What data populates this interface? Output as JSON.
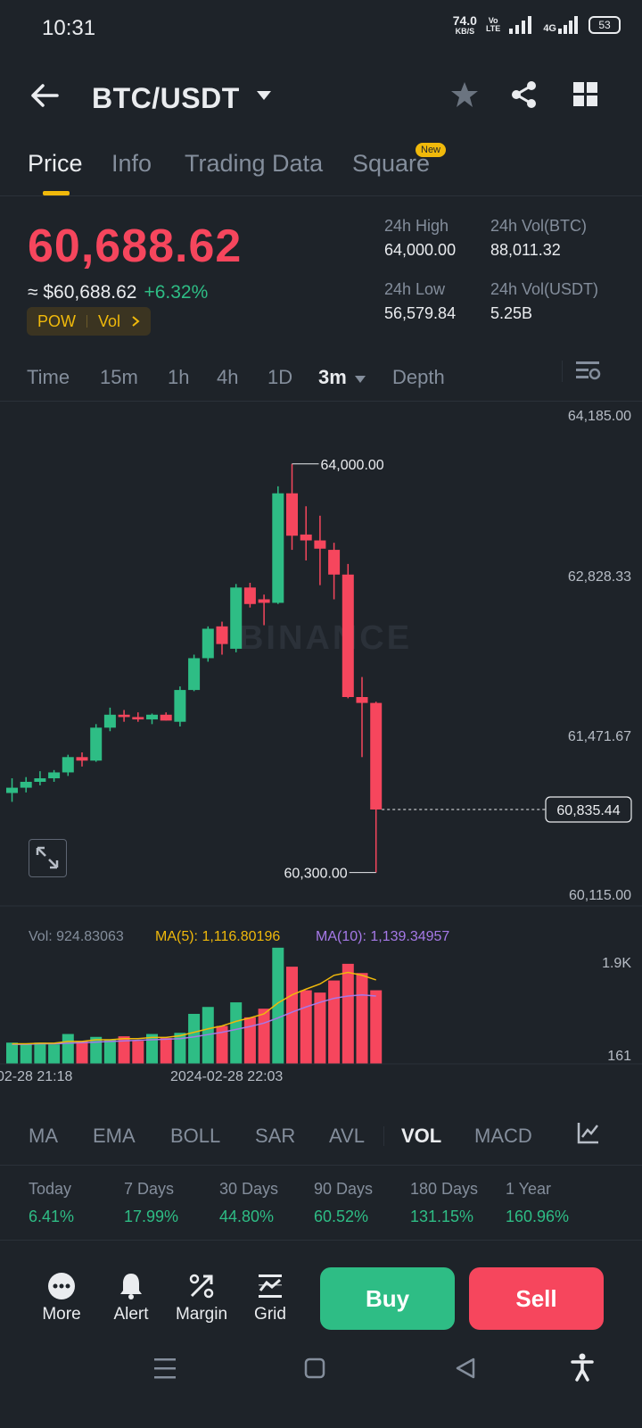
{
  "status": {
    "time": "10:31",
    "netspeed_value": "74.0",
    "netspeed_unit": "KB/S",
    "volte_top": "Vo",
    "volte_bottom": "LTE",
    "network": "4G",
    "battery": "53"
  },
  "header": {
    "pair": "BTC/USDT"
  },
  "tabs": [
    {
      "label": "Price"
    },
    {
      "label": "Info"
    },
    {
      "label": "Trading Data"
    },
    {
      "label": "Square",
      "badge": "New"
    }
  ],
  "ticker": {
    "last_price": "60,688.62",
    "fiat_price": "≈ $60,688.62",
    "change": "+6.32%",
    "tags": [
      "POW",
      "Vol"
    ],
    "stats": [
      {
        "label": "24h High",
        "value": "64,000.00"
      },
      {
        "label": "24h Vol(BTC)",
        "value": "88,011.32"
      },
      {
        "label": "24h Low",
        "value": "56,579.84"
      },
      {
        "label": "24h Vol(USDT)",
        "value": "5.25B"
      }
    ]
  },
  "timeframes": {
    "items": [
      "Time",
      "15m",
      "1h",
      "4h",
      "1D",
      "3m",
      "Depth"
    ],
    "selected": "3m"
  },
  "chart_data": {
    "type": "candlestick",
    "price_axis_labels": [
      "64,185.00",
      "62,828.33",
      "61,471.67",
      "60,115.00"
    ],
    "ylim": [
      60115,
      64185
    ],
    "high_marker": "64,000.00",
    "low_marker": "60,300.00",
    "current_price": "60,835.44",
    "watermark": "BINANCE",
    "candles": [
      {
        "o": 60975,
        "h": 61100,
        "l": 60900,
        "c": 61020
      },
      {
        "o": 61020,
        "h": 61110,
        "l": 60980,
        "c": 61070
      },
      {
        "o": 61070,
        "h": 61160,
        "l": 61040,
        "c": 61100
      },
      {
        "o": 61100,
        "h": 61170,
        "l": 61070,
        "c": 61150
      },
      {
        "o": 61150,
        "h": 61300,
        "l": 61120,
        "c": 61280
      },
      {
        "o": 61280,
        "h": 61320,
        "l": 61200,
        "c": 61250
      },
      {
        "o": 61250,
        "h": 61560,
        "l": 61240,
        "c": 61530
      },
      {
        "o": 61530,
        "h": 61700,
        "l": 61500,
        "c": 61640
      },
      {
        "o": 61640,
        "h": 61680,
        "l": 61580,
        "c": 61620
      },
      {
        "o": 61620,
        "h": 61660,
        "l": 61580,
        "c": 61600
      },
      {
        "o": 61600,
        "h": 61650,
        "l": 61560,
        "c": 61640
      },
      {
        "o": 61640,
        "h": 61660,
        "l": 61590,
        "c": 61590
      },
      {
        "o": 61580,
        "h": 61880,
        "l": 61540,
        "c": 61850
      },
      {
        "o": 61850,
        "h": 62150,
        "l": 61840,
        "c": 62120
      },
      {
        "o": 62120,
        "h": 62390,
        "l": 62090,
        "c": 62370
      },
      {
        "o": 62390,
        "h": 62430,
        "l": 62150,
        "c": 62240
      },
      {
        "o": 62200,
        "h": 62750,
        "l": 62170,
        "c": 62720
      },
      {
        "o": 62720,
        "h": 62760,
        "l": 62550,
        "c": 62580
      },
      {
        "o": 62620,
        "h": 62660,
        "l": 62400,
        "c": 62590
      },
      {
        "o": 62590,
        "h": 63580,
        "l": 62580,
        "c": 63520
      },
      {
        "o": 63520,
        "h": 63770,
        "l": 63040,
        "c": 63160
      },
      {
        "o": 63170,
        "h": 63410,
        "l": 62950,
        "c": 63120
      },
      {
        "o": 63120,
        "h": 63330,
        "l": 62740,
        "c": 63050
      },
      {
        "o": 63040,
        "h": 63100,
        "l": 62620,
        "c": 62830
      },
      {
        "o": 62830,
        "h": 62920,
        "l": 61780,
        "c": 61790
      },
      {
        "o": 61790,
        "h": 61960,
        "l": 61280,
        "c": 61740
      },
      {
        "o": 61740,
        "h": 61750,
        "l": 60300,
        "c": 60835
      }
    ],
    "volume": {
      "summary_label": "Vol: 924.83063",
      "ma5_label": "MA(5): 1,116.80196",
      "ma10_label": "MA(10): 1,139.34957",
      "axis_labels": [
        "1.9K",
        "161"
      ],
      "ylim": [
        161,
        1900
      ],
      "values": [
        330,
        300,
        330,
        300,
        480,
        350,
        430,
        380,
        440,
        360,
        480,
        410,
        500,
        830,
        950,
        620,
        1030,
        770,
        920,
        1980,
        1650,
        1240,
        1200,
        1410,
        1700,
        1540,
        1240
      ],
      "ma5": [
        310,
        310,
        320,
        320,
        350,
        350,
        380,
        380,
        400,
        400,
        420,
        420,
        450,
        510,
        570,
        620,
        700,
        760,
        830,
        1020,
        1160,
        1260,
        1350,
        1500,
        1550,
        1500,
        1420
      ],
      "ma10": [
        300,
        300,
        310,
        310,
        320,
        330,
        340,
        350,
        360,
        370,
        380,
        390,
        400,
        430,
        470,
        510,
        560,
        610,
        670,
        760,
        860,
        950,
        1030,
        1100,
        1140,
        1160,
        1140
      ]
    },
    "time_labels": [
      "02-28 21:18",
      "2024-02-28 22:03"
    ]
  },
  "indicators": {
    "items": [
      "MA",
      "EMA",
      "BOLL",
      "SAR",
      "AVL",
      "VOL",
      "MACD"
    ],
    "selected": "VOL"
  },
  "performance": [
    {
      "label": "Today",
      "value": "6.41%"
    },
    {
      "label": "7 Days",
      "value": "17.99%"
    },
    {
      "label": "30 Days",
      "value": "44.80%"
    },
    {
      "label": "90 Days",
      "value": "60.52%"
    },
    {
      "label": "180 Days",
      "value": "131.15%"
    },
    {
      "label": "1 Year",
      "value": "160.96%"
    }
  ],
  "actions": {
    "more": "More",
    "alert": "Alert",
    "margin": "Margin",
    "grid": "Grid",
    "buy": "Buy",
    "sell": "Sell"
  },
  "colors": {
    "up": "#2ebd85",
    "down": "#f6465d",
    "accent": "#f0b90b",
    "ma5": "#f0b90b",
    "ma10": "#a679e8",
    "bg": "#1e2329"
  }
}
